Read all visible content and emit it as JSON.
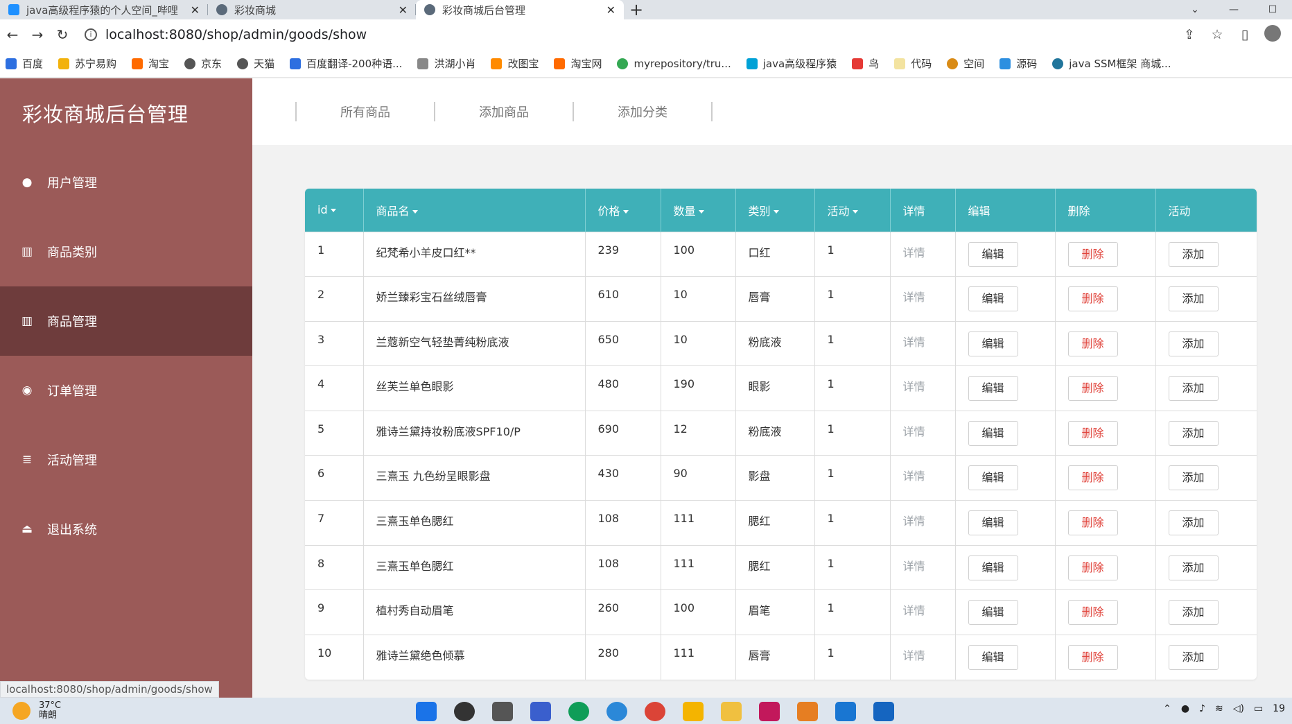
{
  "browser": {
    "tabs": [
      {
        "title": "java高级程序猿的个人空间_哔哩",
        "active": false
      },
      {
        "title": "彩妆商城",
        "active": false
      },
      {
        "title": "彩妆商城后台管理",
        "active": true
      }
    ],
    "new_tab": "+",
    "address": "localhost:8080/shop/admin/goods/show",
    "bookmarks": [
      "百度",
      "苏宁易购",
      "淘宝",
      "京东",
      "天猫",
      "百度翻译-200种语...",
      "洪湖小肖",
      "改图宝",
      "淘宝网",
      "myrepository/tru...",
      "java高级程序猿",
      "鸟",
      "代码",
      "空间",
      "源码",
      "java SSM框架 商城..."
    ]
  },
  "sidebar": {
    "brand": "彩妆商城后台管理",
    "items": [
      {
        "label": "用户管理",
        "icon": "user-icon",
        "active": false
      },
      {
        "label": "商品类别",
        "icon": "bar-chart-icon",
        "active": false
      },
      {
        "label": "商品管理",
        "icon": "bar-chart-icon",
        "active": true
      },
      {
        "label": "订单管理",
        "icon": "users-icon",
        "active": false
      },
      {
        "label": "活动管理",
        "icon": "database-icon",
        "active": false
      },
      {
        "label": "退出系统",
        "icon": "eject-icon",
        "active": false
      }
    ]
  },
  "topnav": {
    "links": [
      "所有商品",
      "添加商品",
      "添加分类"
    ]
  },
  "table": {
    "headers": [
      "id",
      "商品名",
      "价格",
      "数量",
      "类别",
      "活动",
      "详情",
      "编辑",
      "删除",
      "活动"
    ],
    "sortable": [
      true,
      true,
      true,
      true,
      true,
      true,
      false,
      false,
      false,
      false
    ],
    "detail_label": "详情",
    "edit_label": "编辑",
    "delete_label": "删除",
    "add_label": "添加",
    "rows": [
      {
        "id": "1",
        "name": "纪梵希小羊皮口红**",
        "price": "239",
        "qty": "100",
        "category": "口红",
        "activity": "1"
      },
      {
        "id": "2",
        "name": "娇兰臻彩宝石丝绒唇膏",
        "price": "610",
        "qty": "10",
        "category": "唇膏",
        "activity": "1"
      },
      {
        "id": "3",
        "name": "兰蔻新空气轻垫菁纯粉底液",
        "price": "650",
        "qty": "10",
        "category": "粉底液",
        "activity": "1"
      },
      {
        "id": "4",
        "name": "丝芙兰单色眼影",
        "price": "480",
        "qty": "190",
        "category": "眼影",
        "activity": "1"
      },
      {
        "id": "5",
        "name": "雅诗兰黛持妆粉底液SPF10/P",
        "price": "690",
        "qty": "12",
        "category": "粉底液",
        "activity": "1"
      },
      {
        "id": "6",
        "name": "三熹玉 九色纷呈眼影盘",
        "price": "430",
        "qty": "90",
        "category": "影盘",
        "activity": "1"
      },
      {
        "id": "7",
        "name": "三熹玉单色腮红",
        "price": "108",
        "qty": "111",
        "category": "腮红",
        "activity": "1"
      },
      {
        "id": "8",
        "name": "三熹玉单色腮红",
        "price": "108",
        "qty": "111",
        "category": "腮红",
        "activity": "1"
      },
      {
        "id": "9",
        "name": "植村秀自动眉笔",
        "price": "260",
        "qty": "100",
        "category": "眉笔",
        "activity": "1"
      },
      {
        "id": "10",
        "name": "雅诗兰黛绝色倾慕",
        "price": "280",
        "qty": "111",
        "category": "唇膏",
        "activity": "1"
      }
    ]
  },
  "status_url": "localhost:8080/shop/admin/goods/show",
  "taskbar": {
    "temperature": "37°C",
    "weather": "晴朗",
    "clock": "19"
  },
  "colors": {
    "sidebar": "#9b5a58",
    "sidebar_active": "#6e3c3c",
    "table_header": "#3fb0b8",
    "delete_text": "#e0423a"
  }
}
